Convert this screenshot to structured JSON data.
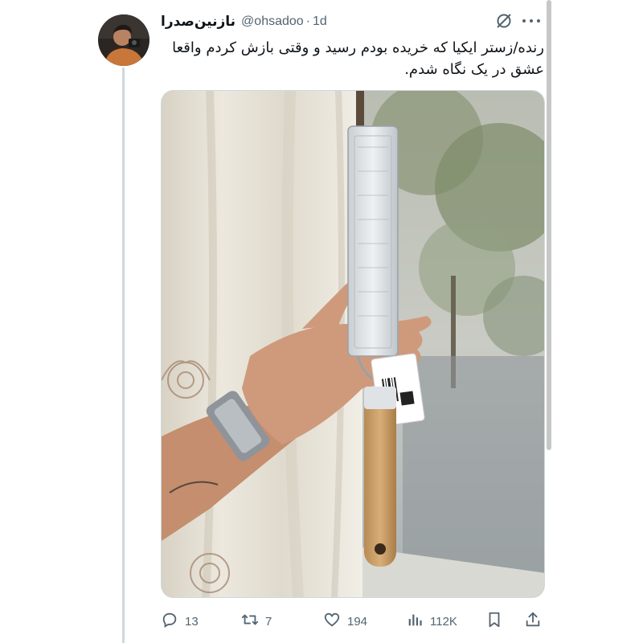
{
  "author": {
    "display_name": "نازنین‌صدرا",
    "handle": "@ohsadoo",
    "separator": "·",
    "time": "1d"
  },
  "tweet": {
    "text": "رنده/زستر ایکیا که خریده بودم رسید و وقتی بازش کردم واقعا عشق در یک نگاه شدم."
  },
  "media": {
    "description_icon": "photo-hand-holding-grater"
  },
  "actions": {
    "reply_count": "13",
    "retweet_count": "7",
    "like_count": "194",
    "views_count": "112K"
  },
  "icons": {
    "grok": "grok-icon",
    "more": "more-icon",
    "reply": "reply-icon",
    "retweet": "retweet-icon",
    "like": "like-icon",
    "views": "views-icon",
    "bookmark": "bookmark-icon",
    "share": "share-icon"
  }
}
